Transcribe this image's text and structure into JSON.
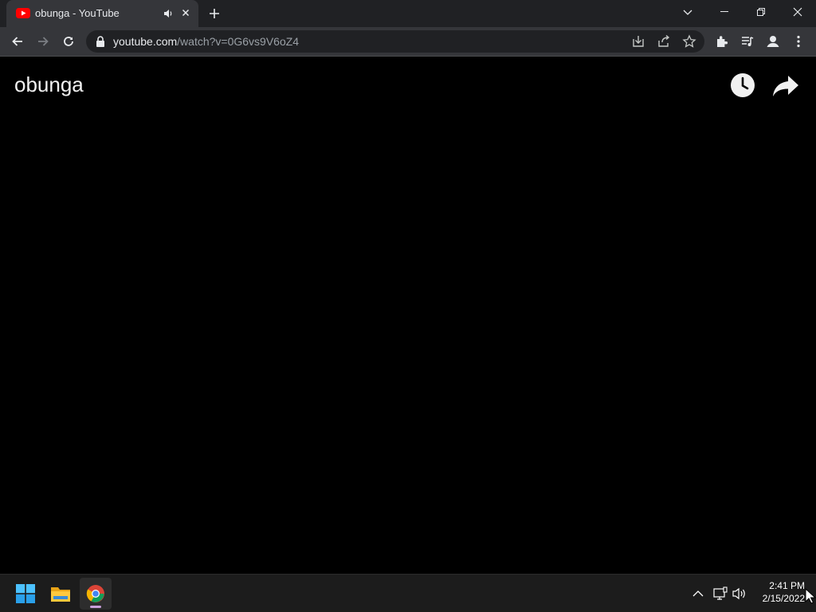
{
  "browser": {
    "tab": {
      "title": "obunga - YouTube",
      "favicon": "youtube-icon",
      "audio_indicator": "speaker-icon",
      "close": "close-icon"
    },
    "new_tab": "plus-icon",
    "window_controls": [
      "chevron-down-icon",
      "minimize-icon",
      "restore-icon",
      "close-icon"
    ],
    "toolbar": {
      "back": "back-arrow-icon",
      "forward": "forward-arrow-icon",
      "reload": "reload-icon",
      "url_host": "youtube.com",
      "url_path": "/watch?v=0G6vs9V6oZ4",
      "omnibox_icons": [
        "install-icon",
        "share-icon",
        "star-icon"
      ],
      "extensions": [
        "puzzle-icon",
        "media-control-icon",
        "profile-icon",
        "more-icon"
      ]
    }
  },
  "player": {
    "title": "obunga",
    "watch_later": "clock-icon",
    "share": "share-arrow-icon"
  },
  "taskbar": {
    "apps": [
      "windows-start-icon",
      "file-explorer-icon",
      "chrome-icon"
    ],
    "tray": [
      "chevron-up-icon",
      "network-icon",
      "volume-icon"
    ],
    "time": "2:41 PM",
    "date": "2/15/2022"
  },
  "colors": {
    "titlebar": "#202124",
    "toolbar": "#35363a",
    "page_bg": "#000000",
    "youtube_red": "#ff0000",
    "taskbar": "#1c1c1c"
  }
}
